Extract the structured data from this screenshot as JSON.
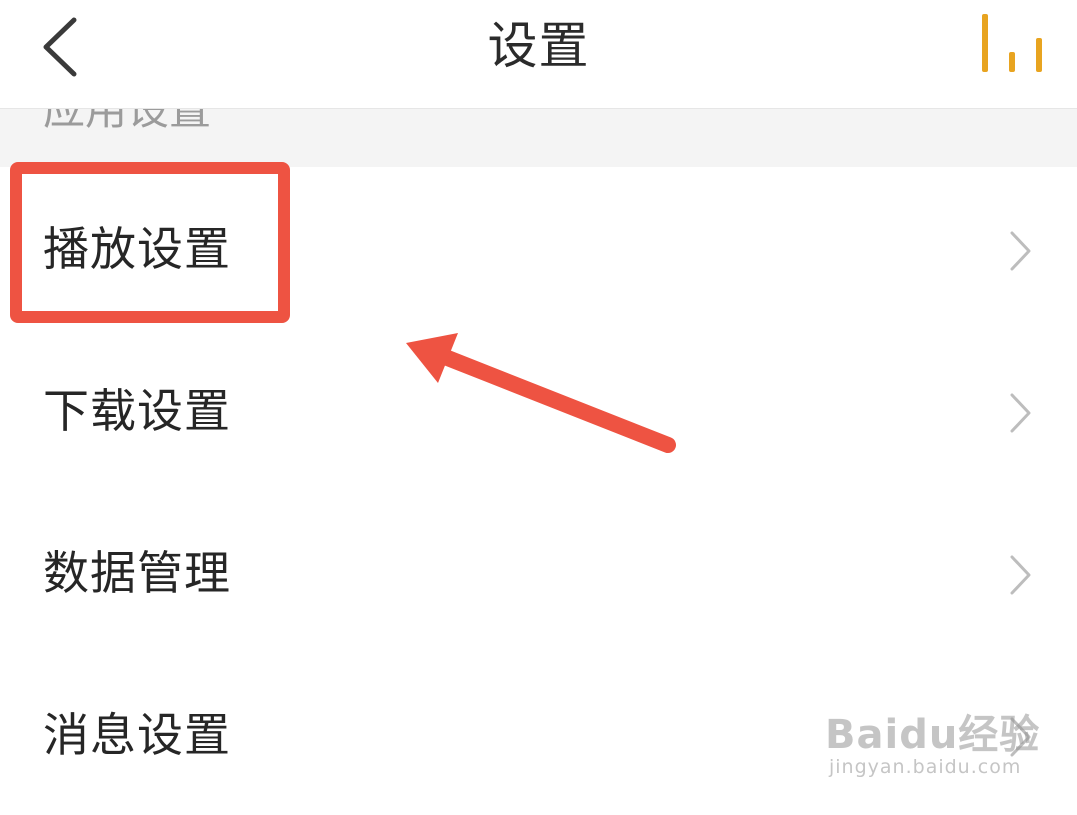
{
  "header": {
    "title": "设置",
    "back_icon": "chevron-left-icon",
    "right_icon": "equalizer-icon",
    "accent_color": "#E8A420"
  },
  "section": {
    "label": "应用设置"
  },
  "settings_items": [
    {
      "label": "播放设置",
      "icon": "chevron-right-icon"
    },
    {
      "label": "下载设置",
      "icon": "chevron-right-icon"
    },
    {
      "label": "数据管理",
      "icon": "chevron-right-icon"
    },
    {
      "label": "消息设置",
      "icon": "chevron-right-icon"
    }
  ],
  "annotation": {
    "color": "#EE5342",
    "target": "播放设置"
  },
  "watermark": {
    "main": "Baidu经验",
    "sub": "jingyan.baidu.com"
  }
}
